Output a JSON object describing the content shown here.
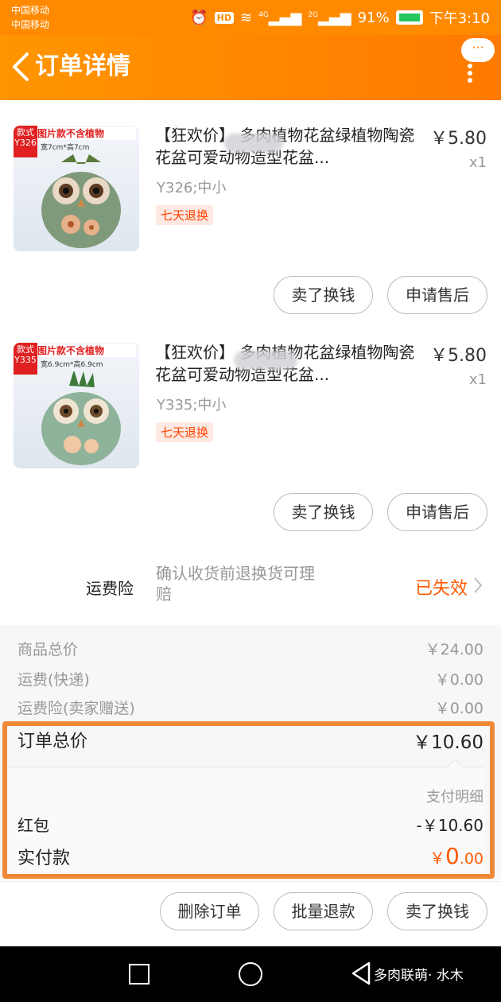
{
  "status_bar": {
    "carrier_1": "中国移动",
    "carrier_2": "中国移动",
    "hd": "HD",
    "net_1": "4G",
    "net_2": "2G",
    "battery_text": "91%",
    "time": "下午3:10"
  },
  "header": {
    "title": "订单详情",
    "more_label": "···"
  },
  "items": [
    {
      "image_tag": "款式Y326",
      "image_banner": "图片款不含植物",
      "image_size_note": "宽7cm*高7cm",
      "title": "【狂欢价】 多肉植物花盆绿植物陶瓷花盆可爱动物造型花盆...",
      "price": "￥5.80",
      "qty": "x1",
      "spec": "Y326;中小",
      "badge": "七天退换",
      "btn_sell": "卖了换钱",
      "btn_after_sale": "申请售后"
    },
    {
      "image_tag": "款式Y335",
      "image_banner": "图片款不含植物",
      "image_size_note": "宽6.9cm*高6.9cm",
      "title": "【狂欢价】 多肉植物花盆绿植物陶瓷花盆可爱动物造型花盆...",
      "price": "￥5.80",
      "qty": "x1",
      "spec": "Y335;中小",
      "badge": "七天退换",
      "btn_sell": "卖了换钱",
      "btn_after_sale": "申请售后"
    }
  ],
  "insurance": {
    "label": "运费险",
    "desc": "确认收货前退换货可理赔",
    "status": "已失效"
  },
  "summary": {
    "goods_total_label": "商品总价",
    "goods_total_value": "￥24.00",
    "shipping_label": "运费(快递)",
    "shipping_value": "￥0.00",
    "insurance_fee_label": "运费险(卖家赠送)",
    "insurance_fee_value": "￥0.00",
    "order_total_label": "订单总价",
    "order_total_value": "￥10.60",
    "pay_detail_title": "支付明细",
    "red_packet_label": "红包",
    "red_packet_value": "-￥10.60",
    "actual_paid_label": "实付款",
    "actual_paid_yen": "￥",
    "actual_paid_int": "0",
    "actual_paid_dec": ".00"
  },
  "actions": {
    "delete_order": "删除订单",
    "batch_refund": "批量退款",
    "sell_for_money": "卖了换钱"
  },
  "watermark": "多肉联萌· 水木",
  "colors": {
    "brand_orange": "#ff8a00",
    "price_orange": "#ff5a00",
    "highlight_border": "#f08a38"
  }
}
